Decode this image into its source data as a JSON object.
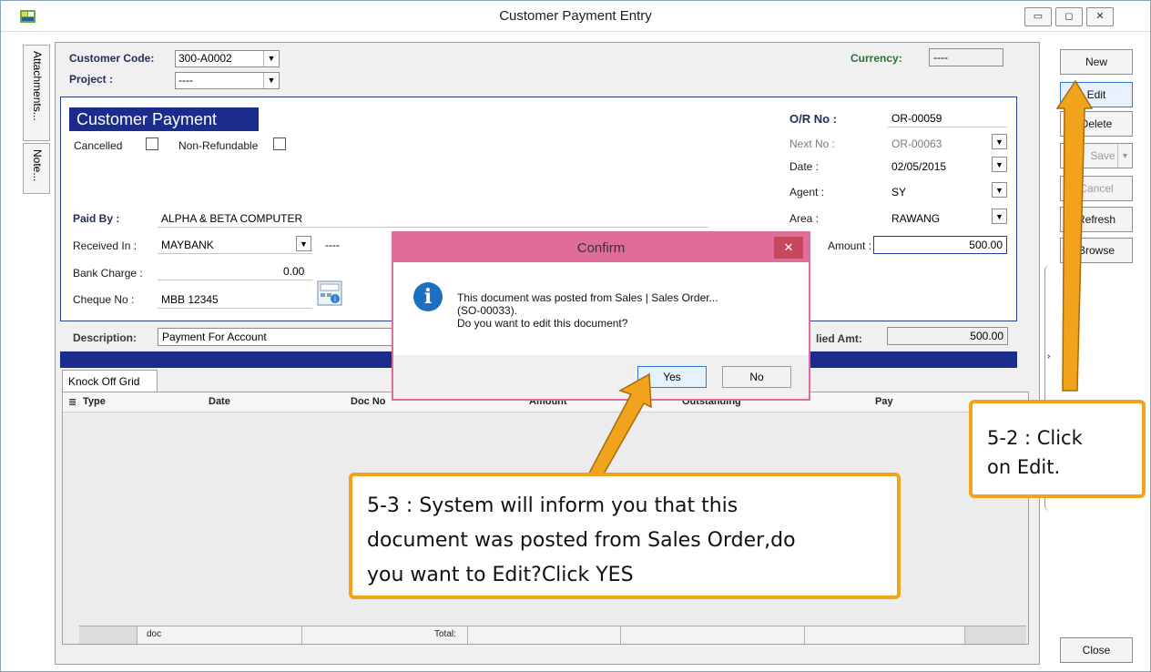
{
  "window": {
    "title": "Customer Payment Entry",
    "controls": [
      "minimize",
      "maximize",
      "close"
    ]
  },
  "side_tabs": [
    "Attachments...",
    "Note..."
  ],
  "header": {
    "customer_code_label": "Customer Code:",
    "customer_code": "300-A0002",
    "project_label": "Project :",
    "project": "----",
    "currency_label": "Currency:",
    "currency": "----"
  },
  "form": {
    "section_title": "Customer Payment",
    "cancelled_label": "Cancelled",
    "non_refundable_label": "Non-Refundable",
    "paid_by_label": "Paid By :",
    "paid_by": "ALPHA & BETA COMPUTER",
    "received_in_label": "Received In :",
    "received_in": "MAYBANK",
    "received_in_extra": "----",
    "bank_charge_label": "Bank Charge :",
    "bank_charge": "0.00",
    "cheque_no_label": "Cheque No :",
    "cheque_no": "MBB 12345",
    "or_no_label": "O/R No :",
    "or_no": "OR-00059",
    "next_no_label": "Next No :",
    "next_no": "OR-00063",
    "date_label": "Date :",
    "date": "02/05/2015",
    "agent_label": "Agent :",
    "agent": "SY",
    "area_label": "Area :",
    "area": "RAWANG",
    "amount_label": "Amount :",
    "amount": "500.00",
    "description_label": "Description:",
    "description": "Payment For Account",
    "applied_amt_label": "lied Amt:",
    "applied_amt": "500.00"
  },
  "grid": {
    "tab_label": "Knock Off Grid",
    "columns": [
      "Type",
      "Date",
      "Doc No",
      "Amount",
      "Outstanding",
      "Pay"
    ],
    "footer_doc": "doc",
    "footer_total": "Total:"
  },
  "buttons": {
    "new": "New",
    "edit": "Edit",
    "delete": "Delete",
    "save": "Save",
    "cancel": "Cancel",
    "refresh": "Refresh",
    "browse": "Browse",
    "close": "Close"
  },
  "dialog": {
    "title": "Confirm",
    "close": "✕",
    "message_line1": "This document was posted from Sales | Sales Order...",
    "message_line2": "(SO-00033).",
    "message_line3": "Do you want to edit this document?",
    "yes": "Yes",
    "no": "No"
  },
  "callouts": {
    "step_5_2_line1": "5-2 : Click",
    "step_5_2_line2": "on Edit.",
    "step_5_3_line1": "5-3 : System will inform you that this",
    "step_5_3_line2": "document was posted from Sales Order,do",
    "step_5_3_line3": "you want to Edit?Click YES"
  },
  "colors": {
    "accent_blue": "#1b2c8c",
    "dialog_pink": "#e06c9a",
    "callout_orange": "#f1a31b"
  }
}
